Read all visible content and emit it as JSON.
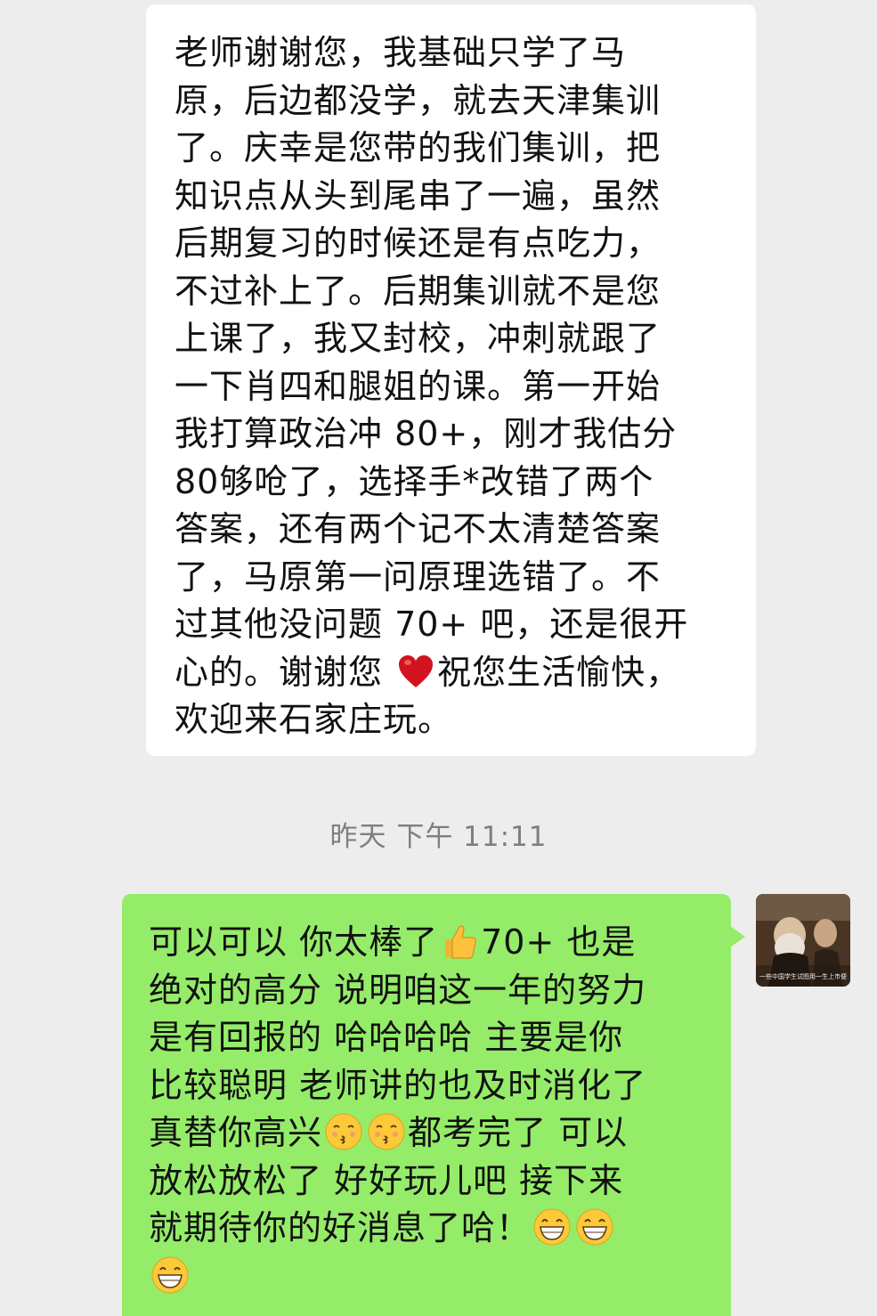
{
  "incoming_message": {
    "lines": [
      {
        "segments": [
          {
            "text": "老师谢谢您，我基础只学了马"
          }
        ]
      },
      {
        "segments": [
          {
            "text": "原，后边都没学，就去天津集训"
          }
        ]
      },
      {
        "segments": [
          {
            "text": "了。庆幸是您带的我们集训，把"
          }
        ]
      },
      {
        "segments": [
          {
            "text": "知识点从头到尾串了一遍，虽然"
          }
        ]
      },
      {
        "segments": [
          {
            "text": "后期复习的时候还是有点吃力，"
          }
        ]
      },
      {
        "segments": [
          {
            "text": "不过补上了。后期集训就不是您"
          }
        ]
      },
      {
        "segments": [
          {
            "text": "上课了，我又封校，冲刺就跟了"
          }
        ]
      },
      {
        "segments": [
          {
            "text": "一下肖四和腿姐的课。第一开始"
          }
        ]
      },
      {
        "segments": [
          {
            "text": "我打算政治冲 80+，刚才我估分"
          }
        ]
      },
      {
        "segments": [
          {
            "text": "80够呛了，选择手*改错了两个"
          }
        ]
      },
      {
        "segments": [
          {
            "text": "答案，还有两个记不太清楚答案"
          }
        ]
      },
      {
        "segments": [
          {
            "text": "了，马原第一问原理选错了。不"
          }
        ]
      },
      {
        "segments": [
          {
            "text": "过其他没问题 70+ 吧，还是很开"
          }
        ]
      },
      {
        "segments": [
          {
            "text": "心的。谢谢您 "
          },
          {
            "emoji": "heart-emoji"
          },
          {
            "text": "祝您生活愉快，"
          }
        ]
      },
      {
        "segments": [
          {
            "text": "欢迎来石家庄玩。"
          }
        ]
      }
    ]
  },
  "timestamp": "昨天 下午 11:11",
  "outgoing_message": {
    "lines": [
      {
        "segments": [
          {
            "text": "可以可以 你太棒了"
          },
          {
            "emoji": "thumbs-up-emoji"
          },
          {
            "text": "70+ 也是"
          }
        ]
      },
      {
        "segments": [
          {
            "text": "绝对的高分 说明咱这一年的努力"
          }
        ]
      },
      {
        "segments": [
          {
            "text": "是有回报的 哈哈哈哈 主要是你"
          }
        ]
      },
      {
        "segments": [
          {
            "text": "比较聪明 老师讲的也及时消化了"
          }
        ]
      },
      {
        "segments": [
          {
            "text": " 真替你高兴"
          },
          {
            "emoji": "kissing-emoji"
          },
          {
            "emoji": "kissing-emoji"
          },
          {
            "text": "都考完了 可以"
          }
        ]
      },
      {
        "segments": [
          {
            "text": "放松放松了 好好玩儿吧 接下来"
          }
        ]
      },
      {
        "segments": [
          {
            "text": "就期待你的好消息了哈！"
          },
          {
            "emoji": "grin-emoji"
          },
          {
            "emoji": "grin-emoji"
          }
        ]
      },
      {
        "segments": [
          {
            "emoji": "grin-emoji"
          }
        ]
      }
    ]
  },
  "avatar": {
    "icon": "portrait-painting-avatar",
    "caption": "一些中国学生试图用一生上市便我们深深的思想"
  },
  "colors": {
    "background": "#ededed",
    "incoming_bubble": "#ffffff",
    "outgoing_bubble": "#95ec69",
    "timestamp_text": "#7f7f7f"
  }
}
